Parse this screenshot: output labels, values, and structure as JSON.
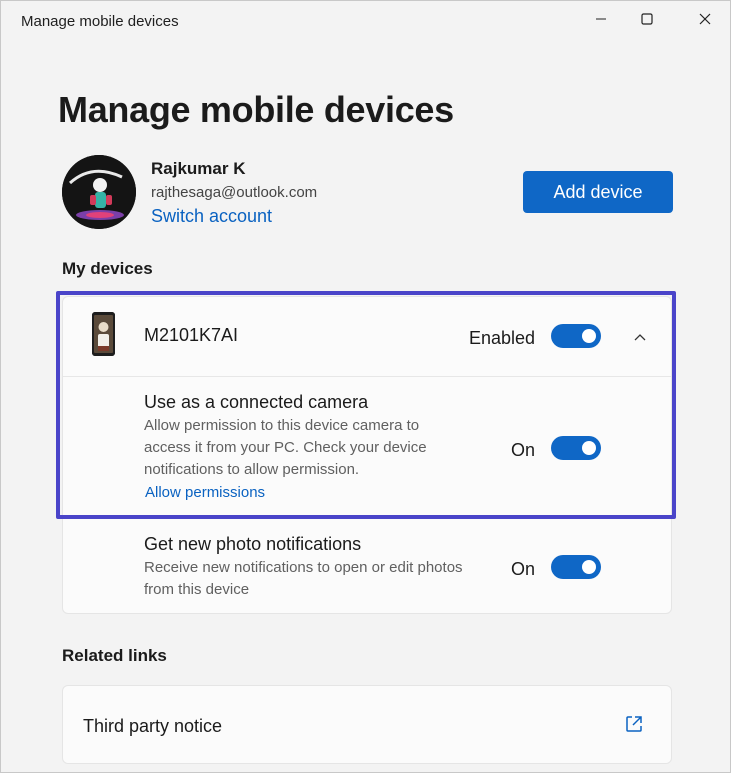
{
  "window": {
    "title": "Manage mobile devices"
  },
  "page": {
    "title": "Manage mobile devices"
  },
  "account": {
    "name": "Rajkumar K",
    "email": "rajthesaga@outlook.com",
    "switch_label": "Switch account"
  },
  "actions": {
    "add_device_label": "Add device"
  },
  "sections": {
    "my_devices": "My devices",
    "related_links": "Related links"
  },
  "device": {
    "name": "M2101K7AI",
    "state_label": "Enabled",
    "enabled": true,
    "expanded": true,
    "settings": [
      {
        "title": "Use as a connected camera",
        "description": "Allow permission to this device camera to access it from your PC. Check your device notifications to allow permission.",
        "link": "Allow permissions",
        "state_label": "On",
        "on": true
      },
      {
        "title": "Get new photo notifications",
        "description": "Receive new notifications to open or edit photos from this device",
        "state_label": "On",
        "on": true
      }
    ]
  },
  "related": {
    "items": [
      {
        "label": "Third party notice",
        "icon": "external-link-icon"
      }
    ]
  },
  "colors": {
    "accent": "#0f67c6",
    "link": "#0a62c1",
    "highlight": "#4a44c9",
    "background": "#f3f3f3"
  }
}
